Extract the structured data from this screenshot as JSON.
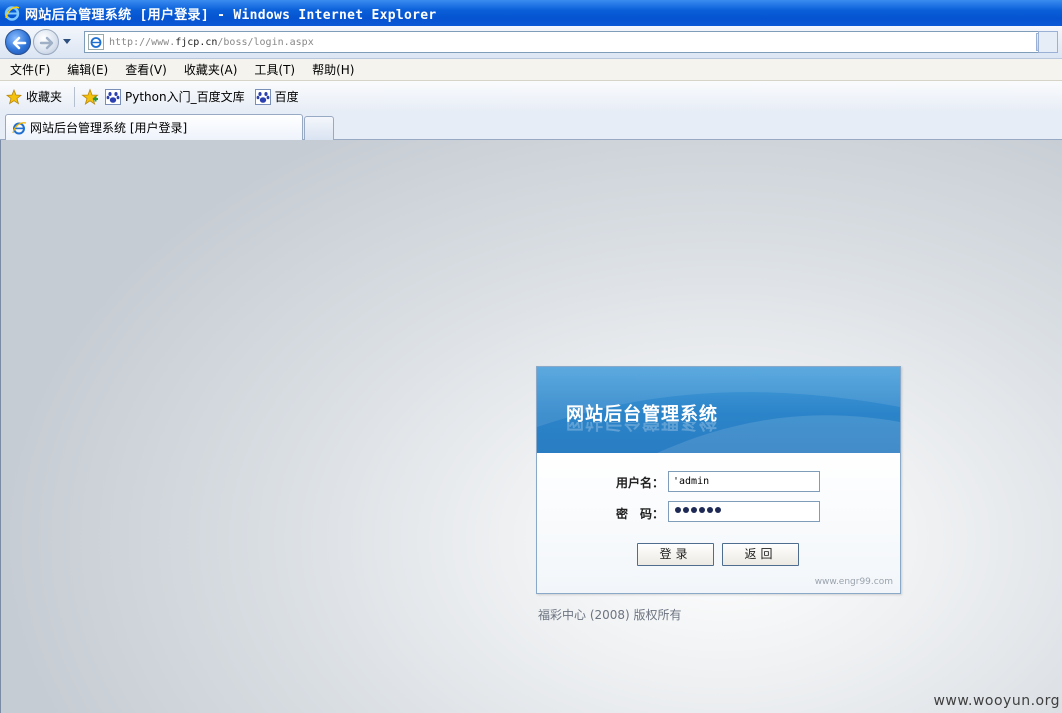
{
  "window": {
    "title": "网站后台管理系统 [用户登录] - Windows Internet Explorer"
  },
  "address": {
    "url_prefix": "http://www.",
    "url_domain": "fjcp.cn",
    "url_path": "/boss/login.aspx"
  },
  "menu": {
    "items": [
      "文件(F)",
      "编辑(E)",
      "查看(V)",
      "收藏夹(A)",
      "工具(T)",
      "帮助(H)"
    ]
  },
  "favorites": {
    "label": "收藏夹",
    "links": [
      "Python入门_百度文库",
      "百度"
    ]
  },
  "tabs": {
    "active_label": "网站后台管理系统 [用户登录]"
  },
  "login": {
    "title": "网站后台管理系统",
    "username_label": "用户名：",
    "username_value": "'admin",
    "password_label": "密　码：",
    "password_dot_count": 6,
    "login_button": "登录",
    "back_button": "返回",
    "credit": "www.engr99.com"
  },
  "footer": {
    "copyright": "福彩中心 (2008) 版权所有",
    "watermark": "www.wooyun.org"
  },
  "colors": {
    "titlebar": "#0a5fd8",
    "login_header": "#2b84c9",
    "content_bg": "#d8dde2"
  }
}
